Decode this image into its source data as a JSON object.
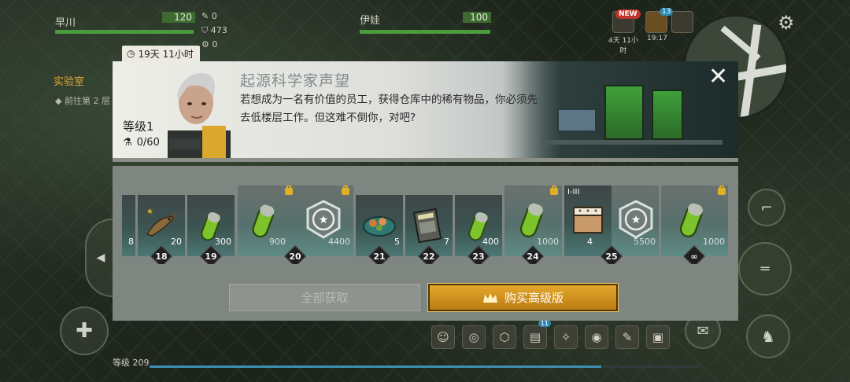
{
  "hud": {
    "player1_name": "早川",
    "player1_hp": "120",
    "player2_name": "伊娃",
    "player2_hp": "100",
    "stat1": "0",
    "stat2": "473",
    "stat3": "0",
    "new_badge": "NEW",
    "event_time": "4天 11小时",
    "event_badge": "13",
    "clock": "19:17",
    "location": "实验室",
    "location_sub": "前往第 2 层",
    "level_label": "等级 209",
    "notif_badge": "11"
  },
  "dialog": {
    "timer": "19天 11小时",
    "title": "起源科学家声望",
    "description": "若想成为一名有价值的员工，获得仓库中的稀有物品，你必须先去低楼层工作。但这难不倒你，对吧?",
    "level": "等级1",
    "progress": "0/60",
    "close_icon": "close-icon",
    "claim_all": "全部获取",
    "buy_premium": "购买高级版"
  },
  "rewards": [
    {
      "level": "",
      "free": {
        "icon": "item-icon",
        "qty": "8"
      }
    },
    {
      "level": "18",
      "free": {
        "icon": "fish-icon",
        "qty": "20"
      }
    },
    {
      "level": "19",
      "free": {
        "icon": "green-capsule-icon",
        "qty": "300"
      }
    },
    {
      "level": "20",
      "free": {
        "icon": "green-capsule-icon",
        "qty": "900"
      },
      "premium": {
        "icon": "reputation-shield-icon",
        "qty": "4400"
      }
    },
    {
      "level": "21",
      "free": {
        "icon": "food-bowl-icon",
        "qty": "5"
      }
    },
    {
      "level": "22",
      "free": {
        "icon": "magazine-icon",
        "qty": "7"
      }
    },
    {
      "level": "23",
      "free": {
        "icon": "green-capsule-icon",
        "qty": "400"
      }
    },
    {
      "level": "24",
      "premium": {
        "icon": "green-capsule-icon",
        "qty": "1000"
      }
    },
    {
      "level": "25",
      "free": {
        "icon": "crate-icon",
        "qty": "4",
        "tag": "I-III"
      },
      "premium": {
        "icon": "reputation-shield-icon",
        "qty": "5500"
      }
    },
    {
      "level": "∞",
      "premium": {
        "icon": "green-capsule-icon",
        "qty": "1000"
      }
    }
  ],
  "colors": {
    "accent_gold": "#e0a52c",
    "hp_green": "#4a9b3c",
    "capsule_green": "#7dc42c"
  }
}
